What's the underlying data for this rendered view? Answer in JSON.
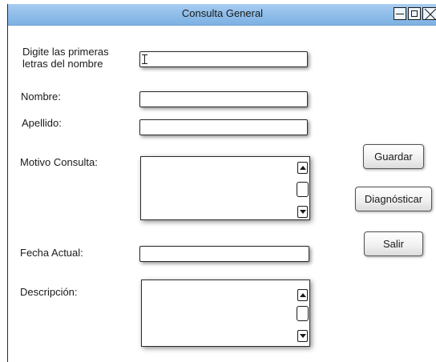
{
  "window": {
    "title": "Consulta General"
  },
  "form": {
    "search_label": "Digite las primeras letras del nombre",
    "search_value": "",
    "nombre_label": "Nombre:",
    "nombre_value": "",
    "apellido_label": "Apellido:",
    "apellido_value": "",
    "motivo_label": "Motivo Consulta:",
    "motivo_value": "",
    "fecha_label": "Fecha Actual:",
    "fecha_value": "",
    "descripcion_label": "Descripción:",
    "descripcion_value": ""
  },
  "buttons": {
    "guardar": "Guardar",
    "diagnosticar": "Diagnósticar",
    "salir": "Salir"
  },
  "colors": {
    "titlebar": "#8fbde9",
    "border": "#2a2a2a"
  },
  "icons": [
    "minimize-icon",
    "maximize-icon",
    "close-icon",
    "text-cursor-icon",
    "scroll-up-icon",
    "scroll-down-icon"
  ]
}
